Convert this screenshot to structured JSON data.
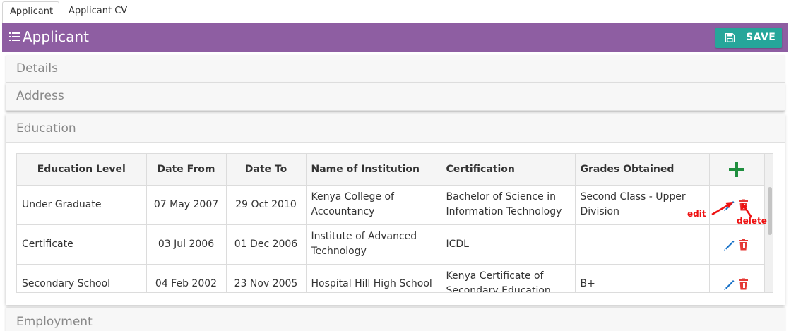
{
  "tabs": [
    {
      "label": "Applicant",
      "active": true
    },
    {
      "label": "Applicant CV",
      "active": false
    }
  ],
  "header": {
    "title": "Applicant",
    "save_label": "SAVE",
    "background": "#8e5ea2",
    "save_color": "#26a69a"
  },
  "panels": {
    "details": "Details",
    "address": "Address",
    "education": "Education",
    "employment": "Employment"
  },
  "education_table": {
    "columns": [
      "Education Level",
      "Date From",
      "Date To",
      "Name of Institution",
      "Certification",
      "Grades Obtained"
    ],
    "rows": [
      {
        "level": "Under Graduate",
        "from": "07 May 2007",
        "to": "29 Oct 2010",
        "institution": "Kenya College of Accountancy",
        "certification": "Bachelor of Science in Information Technology",
        "grades": "Second Class - Upper Division"
      },
      {
        "level": "Certificate",
        "from": "03 Jul 2006",
        "to": "01 Dec 2006",
        "institution": "Institute of Advanced Technology",
        "certification": "ICDL",
        "grades": ""
      },
      {
        "level": "Secondary School",
        "from": "04 Feb 2002",
        "to": "23 Nov 2005",
        "institution": "Hospital Hill High School",
        "certification": "Kenya Certificate of Secondary Education",
        "grades": "B+"
      }
    ],
    "icons": {
      "add": "plus-icon",
      "edit": "pencil-icon",
      "delete": "trash-icon"
    },
    "colors": {
      "add": "#1e8e3e",
      "edit": "#1a73c8",
      "delete": "#e53935"
    }
  },
  "annotations": {
    "edit": "edit",
    "delete": "delete",
    "color": "#ee1111"
  }
}
